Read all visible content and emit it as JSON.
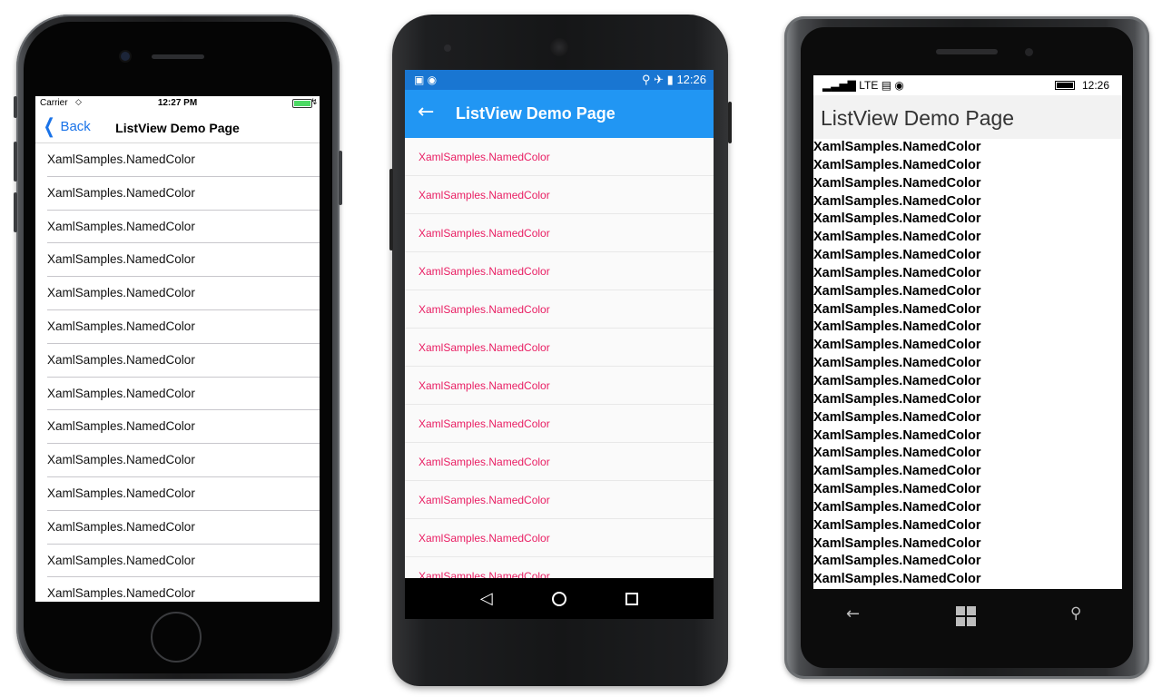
{
  "ios": {
    "status": {
      "carrier": "Carrier",
      "time": "12:27 PM"
    },
    "nav": {
      "back_label": "Back",
      "title": "ListView Demo Page"
    },
    "items": [
      "XamlSamples.NamedColor",
      "XamlSamples.NamedColor",
      "XamlSamples.NamedColor",
      "XamlSamples.NamedColor",
      "XamlSamples.NamedColor",
      "XamlSamples.NamedColor",
      "XamlSamples.NamedColor",
      "XamlSamples.NamedColor",
      "XamlSamples.NamedColor",
      "XamlSamples.NamedColor",
      "XamlSamples.NamedColor",
      "XamlSamples.NamedColor",
      "XamlSamples.NamedColor",
      "XamlSamples.NamedColor"
    ]
  },
  "android": {
    "status": {
      "time": "12:26"
    },
    "toolbar": {
      "title": "ListView Demo Page"
    },
    "accent_color": "#e91e63",
    "toolbar_color": "#2196f3",
    "items": [
      "XamlSamples.NamedColor",
      "XamlSamples.NamedColor",
      "XamlSamples.NamedColor",
      "XamlSamples.NamedColor",
      "XamlSamples.NamedColor",
      "XamlSamples.NamedColor",
      "XamlSamples.NamedColor",
      "XamlSamples.NamedColor",
      "XamlSamples.NamedColor",
      "XamlSamples.NamedColor",
      "XamlSamples.NamedColor",
      "XamlSamples.NamedColor"
    ]
  },
  "winphone": {
    "status": {
      "network": "LTE",
      "time": "12:26"
    },
    "title": "ListView Demo Page",
    "items": [
      "XamlSamples.NamedColor",
      "XamlSamples.NamedColor",
      "XamlSamples.NamedColor",
      "XamlSamples.NamedColor",
      "XamlSamples.NamedColor",
      "XamlSamples.NamedColor",
      "XamlSamples.NamedColor",
      "XamlSamples.NamedColor",
      "XamlSamples.NamedColor",
      "XamlSamples.NamedColor",
      "XamlSamples.NamedColor",
      "XamlSamples.NamedColor",
      "XamlSamples.NamedColor",
      "XamlSamples.NamedColor",
      "XamlSamples.NamedColor",
      "XamlSamples.NamedColor",
      "XamlSamples.NamedColor",
      "XamlSamples.NamedColor",
      "XamlSamples.NamedColor",
      "XamlSamples.NamedColor",
      "XamlSamples.NamedColor",
      "XamlSamples.NamedColor",
      "XamlSamples.NamedColor",
      "XamlSamples.NamedColor",
      "XamlSamples.NamedColor"
    ]
  }
}
